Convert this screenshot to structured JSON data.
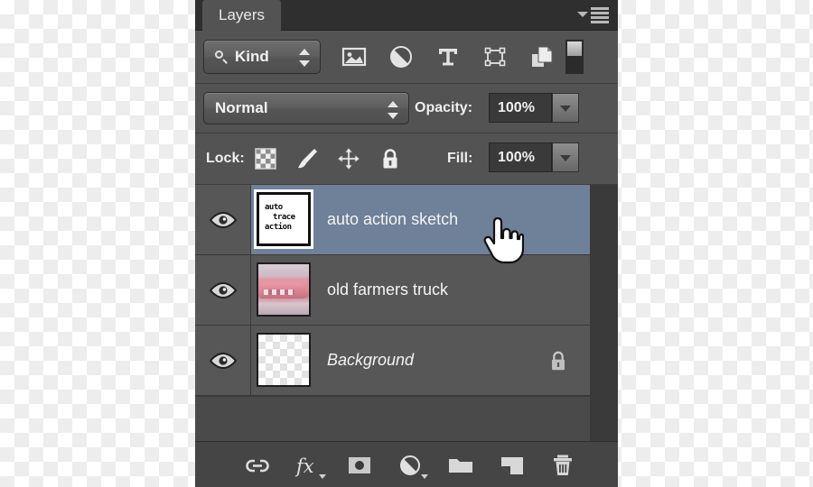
{
  "panel": {
    "tab_label": "Layers",
    "menu_icon": "panel-menu-icon",
    "accent_selected": "#6f8099",
    "bg": "#535353"
  },
  "filter_row": {
    "kind_label": "Kind",
    "search_icon": "magnifier-icon",
    "stepper_icon": "up-down-arrows-icon",
    "icons": [
      {
        "name": "filter-pixel-layers-icon",
        "title": "Filter for pixel layers"
      },
      {
        "name": "filter-adjustment-layers-icon",
        "title": "Filter for adjustment layers"
      },
      {
        "name": "filter-type-layers-icon",
        "title": "Filter for type layers"
      },
      {
        "name": "filter-shape-layers-icon",
        "title": "Filter for shape layers"
      },
      {
        "name": "filter-smart-object-layers-icon",
        "title": "Filter for smart objects"
      }
    ],
    "toggle": {
      "name": "filter-enable-toggle",
      "state": "on"
    }
  },
  "blend_row": {
    "blend_mode": "Normal",
    "opacity_label": "Opacity:",
    "opacity_value": "100%",
    "stepper_icon": "chevron-down-icon"
  },
  "lock_row": {
    "lock_label": "Lock:",
    "fill_label": "Fill:",
    "fill_value": "100%",
    "lock_icons": [
      {
        "name": "lock-transparent-pixels-icon"
      },
      {
        "name": "lock-image-pixels-icon"
      },
      {
        "name": "lock-position-icon"
      },
      {
        "name": "lock-all-icon"
      }
    ]
  },
  "layers": [
    {
      "name": "auto action sketch",
      "visible": true,
      "selected": true,
      "locked": false,
      "italic": false,
      "thumb_kind": "text-sketch",
      "thumb_text": [
        "auto",
        "trace",
        "action"
      ],
      "eye_icon": "eye-icon"
    },
    {
      "name": "old farmers truck",
      "visible": true,
      "selected": false,
      "locked": false,
      "italic": false,
      "thumb_kind": "photo-truck",
      "eye_icon": "eye-icon"
    },
    {
      "name": "Background",
      "visible": true,
      "selected": false,
      "locked": true,
      "italic": true,
      "thumb_kind": "transparent-checker",
      "eye_icon": "eye-icon",
      "lock_icon": "lock-icon"
    }
  ],
  "bottom_bar": {
    "icons": [
      {
        "name": "link-layers-icon",
        "label": "Link layers"
      },
      {
        "name": "layer-style-fx-icon",
        "label": "Add a layer style"
      },
      {
        "name": "add-layer-mask-icon",
        "label": "Add layer mask"
      },
      {
        "name": "new-adjustment-layer-icon",
        "label": "New fill or adjustment layer"
      },
      {
        "name": "new-group-icon",
        "label": "Create a new group"
      },
      {
        "name": "new-layer-icon",
        "label": "Create a new layer"
      },
      {
        "name": "delete-layer-icon",
        "label": "Delete layer"
      }
    ]
  },
  "cursor": {
    "name": "pointing-hand-cursor"
  }
}
